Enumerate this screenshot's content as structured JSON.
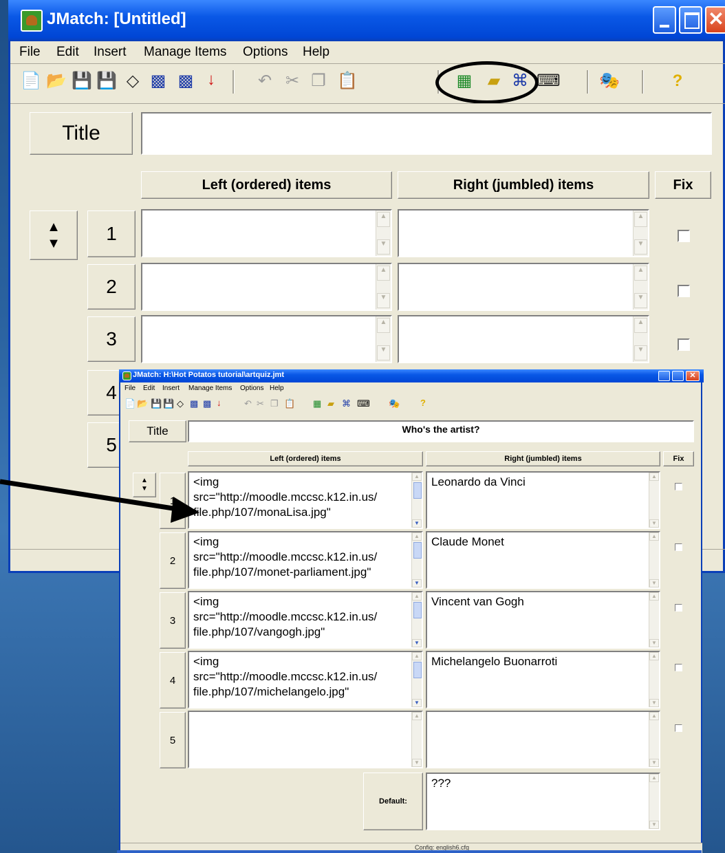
{
  "main_window": {
    "title": "JMatch: [Untitled]",
    "menu": [
      "File",
      "Edit",
      "Insert",
      "Manage Items",
      "Options",
      "Help"
    ],
    "toolbar_icons": [
      "new-file-icon",
      "open-folder-icon",
      "save-icon",
      "save-as-icon",
      "eraser-icon",
      "export-web-icon",
      "export-web-2-icon",
      "red-arrow-icon",
      "undo-icon",
      "cut-icon",
      "copy-icon",
      "paste-icon",
      "config-icon",
      "picture-insert-icon",
      "link-insert-icon",
      "keypad-icon",
      "masks-icon",
      "help-icon"
    ],
    "title_label": "Title",
    "title_value": "",
    "col_left": "Left (ordered) items",
    "col_right": "Right (jumbled) items",
    "col_fix": "Fix",
    "rows": [
      "1",
      "2",
      "3",
      "4",
      "5"
    ]
  },
  "quiz_window": {
    "title": "JMatch: H:\\Hot Potatos tutorial\\artquiz.jmt",
    "menu": [
      "File",
      "Edit",
      "Insert",
      "Manage Items",
      "Options",
      "Help"
    ],
    "title_label": "Title",
    "title_value": "Who's the artist?",
    "col_left": "Left (ordered) items",
    "col_right": "Right (jumbled) items",
    "col_fix": "Fix",
    "rows": [
      {
        "num": "1",
        "left": "<img\nsrc=\"http://moodle.mccsc.k12.in.us/\nfile.php/107/monaLisa.jpg\"",
        "right": "Leonardo da Vinci"
      },
      {
        "num": "2",
        "left": "<img\nsrc=\"http://moodle.mccsc.k12.in.us/\nfile.php/107/monet-parliament.jpg\"",
        "right": "Claude Monet"
      },
      {
        "num": "3",
        "left": "<img\nsrc=\"http://moodle.mccsc.k12.in.us/\nfile.php/107/vangogh.jpg\"",
        "right": "Vincent van Gogh"
      },
      {
        "num": "4",
        "left": "<img\nsrc=\"http://moodle.mccsc.k12.in.us/\nfile.php/107/michelangelo.jpg\"",
        "right": "Michelangelo Buonarroti"
      },
      {
        "num": "5",
        "left": "",
        "right": ""
      }
    ],
    "default_label": "Default:",
    "default_value": "???",
    "status_text": "Config: english6.cfg"
  }
}
